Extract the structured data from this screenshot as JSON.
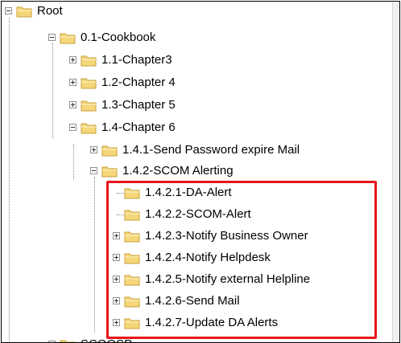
{
  "tree": {
    "nodes": [
      {
        "label": "Root",
        "icon": "folder-icon",
        "expander": "minus"
      },
      {
        "label": "0.1-Cookbook",
        "icon": "folder-icon",
        "expander": "minus"
      },
      {
        "label": "1.1-Chapter3",
        "icon": "folder-icon",
        "expander": "plus"
      },
      {
        "label": "1.2-Chapter 4",
        "icon": "folder-icon",
        "expander": "plus"
      },
      {
        "label": "1.3-Chapter 5",
        "icon": "folder-icon",
        "expander": "plus"
      },
      {
        "label": "1.4-Chapter 6",
        "icon": "folder-icon",
        "expander": "minus"
      },
      {
        "label": "1.4.1-Send Password expire Mail",
        "icon": "folder-icon",
        "expander": "plus"
      },
      {
        "label": "1.4.2-SCOM Alerting",
        "icon": "folder-icon",
        "expander": "minus"
      },
      {
        "label": "1.4.2.1-DA-Alert",
        "icon": "folder-icon",
        "expander": "none"
      },
      {
        "label": "1.4.2.2-SCOM-Alert",
        "icon": "folder-icon",
        "expander": "none"
      },
      {
        "label": "1.4.2.3-Notify Business Owner",
        "icon": "folder-icon",
        "expander": "plus"
      },
      {
        "label": "1.4.2.4-Notify Helpdesk",
        "icon": "folder-icon",
        "expander": "plus"
      },
      {
        "label": "1.4.2.5-Notify external Helpline",
        "icon": "folder-icon",
        "expander": "plus"
      },
      {
        "label": "1.4.2.6-Send Mail",
        "icon": "folder-icon",
        "expander": "plus"
      },
      {
        "label": "1.4.2.7-Update DA Alerts",
        "icon": "folder-icon",
        "expander": "plus"
      },
      {
        "label": "SCOOSP",
        "icon": "folder-icon",
        "expander": "plus"
      }
    ]
  },
  "colors": {
    "folder_fill": "#f5d77a",
    "folder_edge": "#c9a13a",
    "highlight_border": "#e8141c",
    "tree_line": "#8a8a8a"
  }
}
